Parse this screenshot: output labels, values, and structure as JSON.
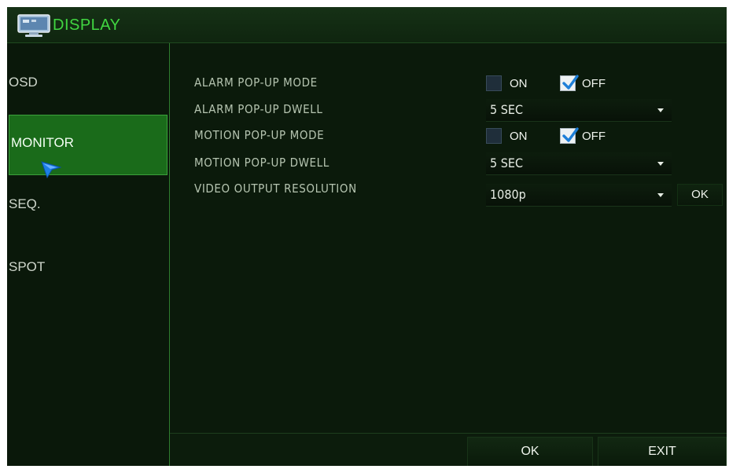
{
  "window": {
    "title": "DISPLAY",
    "icon": "monitor-icon"
  },
  "sidebar": {
    "items": [
      {
        "label": "OSD",
        "active": false
      },
      {
        "label": "MONITOR",
        "active": true
      },
      {
        "label": "SEQ.",
        "active": false
      },
      {
        "label": "SPOT",
        "active": false
      }
    ]
  },
  "settings": {
    "alarm_popup_mode": {
      "label": "ALARM POP-UP MODE",
      "on_label": "ON",
      "off_label": "OFF",
      "selected": "OFF"
    },
    "alarm_popup_dwell": {
      "label": "ALARM POP-UP DWELL",
      "value": "5 SEC"
    },
    "motion_popup_mode": {
      "label": "MOTION POP-UP MODE",
      "on_label": "ON",
      "off_label": "OFF",
      "selected": "OFF"
    },
    "motion_popup_dwell": {
      "label": "MOTION POP-UP DWELL",
      "value": "5 SEC"
    },
    "video_output_resolution": {
      "label": "VIDEO OUTPUT RESOLUTION",
      "value": "1080p",
      "apply_label": "OK"
    }
  },
  "footer": {
    "ok_label": "OK",
    "exit_label": "EXIT"
  },
  "colors": {
    "accent": "#41d641",
    "background": "#0b1a0b",
    "active_item": "#1a6b1a",
    "border": "#2f7d2f"
  }
}
